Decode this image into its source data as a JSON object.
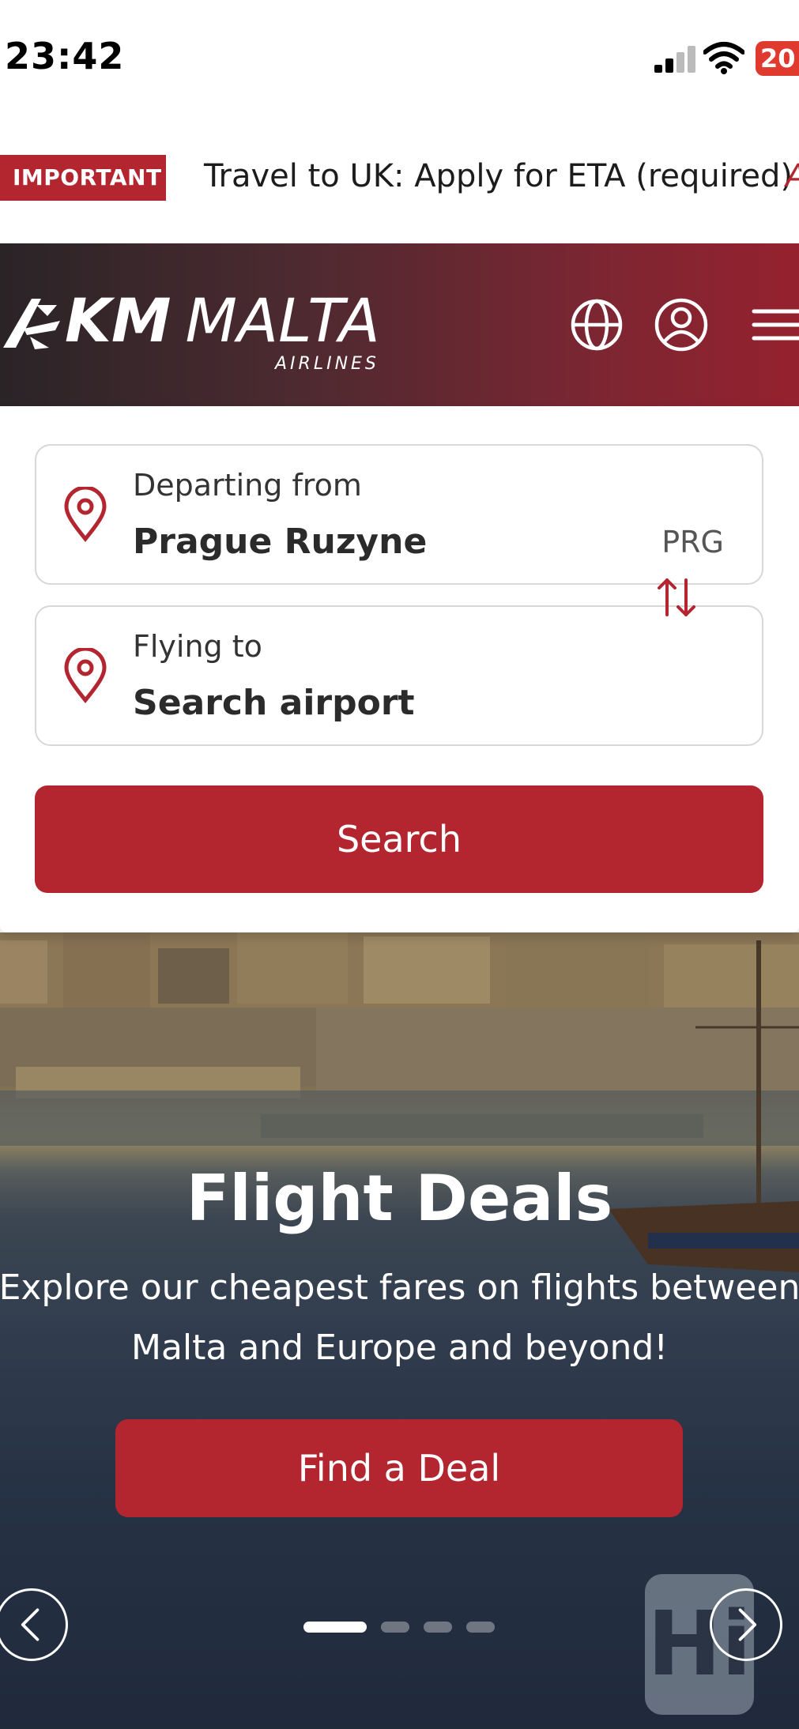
{
  "status_bar": {
    "time": "23:42",
    "battery": "20"
  },
  "notice": {
    "badge": "IMPORTANT",
    "text": "Travel to UK: Apply for ETA (required)",
    "next_char": "A"
  },
  "header": {
    "brand_bold": "KM",
    "brand_light": "MALTA",
    "brand_sub": "AIRLINES",
    "icons": [
      "globe-icon",
      "account-icon",
      "menu-icon"
    ]
  },
  "search": {
    "from": {
      "label": "Departing from",
      "value": "Prague Ruzyne",
      "code": "PRG"
    },
    "to": {
      "label": "Flying to",
      "value": "Search airport"
    },
    "button": "Search"
  },
  "hero": {
    "title": "Flight Deals",
    "description_line1": "Explore our cheapest fares on flights between",
    "description_line2": "Malta and Europe and beyond!",
    "button": "Find a Deal",
    "slide_count": 4,
    "active_slide": 1,
    "badge": "Hi"
  },
  "colors": {
    "brand_red": "#b3262f",
    "header_dark": "#2a2427"
  }
}
